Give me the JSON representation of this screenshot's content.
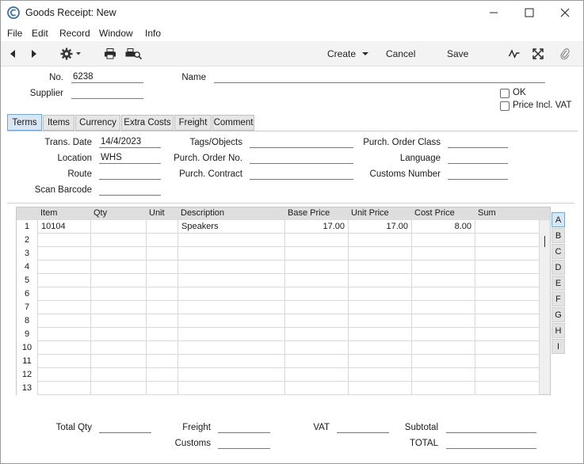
{
  "window": {
    "title": "Goods Receipt: New"
  },
  "menu": [
    "File",
    "Edit",
    "Record",
    "Window",
    "Info"
  ],
  "toolbar": {
    "create": "Create",
    "cancel": "Cancel",
    "save": "Save"
  },
  "header": {
    "no_label": "No.",
    "no_value": "6238",
    "name_label": "Name",
    "name_value": "",
    "supplier_label": "Supplier",
    "supplier_value": "",
    "ok_label": "OK",
    "ok_checked": false,
    "price_incl_vat_label": "Price Incl. VAT",
    "price_incl_vat_checked": false
  },
  "tabs": [
    "Terms",
    "Items",
    "Currency",
    "Extra Costs",
    "Freight",
    "Comment"
  ],
  "active_tab": "Terms",
  "terms": {
    "trans_date_label": "Trans. Date",
    "trans_date_value": "14/4/2023",
    "location_label": "Location",
    "location_value": "WHS",
    "route_label": "Route",
    "route_value": "",
    "scan_barcode_label": "Scan Barcode",
    "scan_barcode_value": "",
    "tags_label": "Tags/Objects",
    "tags_value": "",
    "purch_order_no_label": "Purch. Order No.",
    "purch_order_no_value": "",
    "purch_contract_label": "Purch. Contract",
    "purch_contract_value": "",
    "purch_order_class_label": "Purch. Order Class",
    "purch_order_class_value": "",
    "language_label": "Language",
    "language_value": "",
    "customs_number_label": "Customs Number",
    "customs_number_value": ""
  },
  "grid": {
    "columns": [
      "Item",
      "Qty",
      "Unit",
      "Description",
      "Base Price",
      "Unit Price",
      "Cost Price",
      "Sum"
    ],
    "rows": [
      {
        "n": "1",
        "item": "10104",
        "qty": "",
        "unit": "",
        "description": "Speakers",
        "base_price": "17.00",
        "unit_price": "17.00",
        "cost_price": "8.00",
        "sum": ""
      },
      {
        "n": "2"
      },
      {
        "n": "3"
      },
      {
        "n": "4"
      },
      {
        "n": "5"
      },
      {
        "n": "6"
      },
      {
        "n": "7"
      },
      {
        "n": "8"
      },
      {
        "n": "9"
      },
      {
        "n": "10"
      },
      {
        "n": "11"
      },
      {
        "n": "12"
      },
      {
        "n": "13"
      }
    ],
    "side_tabs": [
      "A",
      "B",
      "C",
      "D",
      "E",
      "F",
      "G",
      "H",
      "I"
    ]
  },
  "footer": {
    "total_qty_label": "Total Qty",
    "total_qty_value": "",
    "freight_label": "Freight",
    "freight_value": "",
    "customs_label": "Customs",
    "customs_value": "",
    "vat_label": "VAT",
    "vat_value": "",
    "subtotal_label": "Subtotal",
    "subtotal_value": "",
    "total_label": "TOTAL",
    "total_value": ""
  }
}
